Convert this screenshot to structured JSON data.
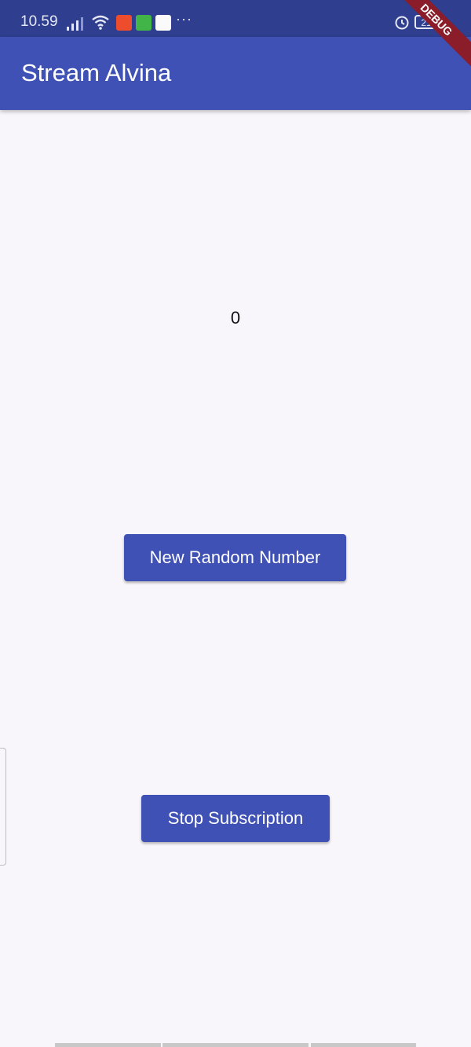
{
  "status_bar": {
    "time": "10.59",
    "battery": "21"
  },
  "app_bar": {
    "title": "Stream Alvina"
  },
  "debug_banner": "DEBUG",
  "main": {
    "counter_value": "0",
    "new_random_label": "New Random Number",
    "stop_label": "Stop Subscription"
  },
  "colors": {
    "app_bar": "#3f51b5",
    "status_bar": "#2f3e8f",
    "button": "#3f51b5",
    "background": "#f8f6fa",
    "debug_ribbon": "#8b1d2a"
  }
}
